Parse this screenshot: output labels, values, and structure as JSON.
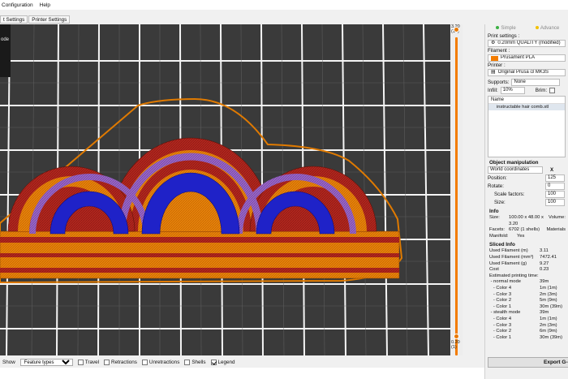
{
  "menu": {
    "items": [
      "Configuration",
      "Help"
    ]
  },
  "tabs": [
    "t Settings",
    "Printer Settings"
  ],
  "legend_overlay": {
    "lines": [
      "ode"
    ]
  },
  "layer_slider": {
    "top_value": "3.20",
    "top_layer": "(16)",
    "bottom_value": "0.20",
    "bottom_layer": "(1)",
    "color": "#f37c00"
  },
  "bottom_bar": {
    "show_label": "Show",
    "view_type": "Feature types",
    "options": [
      {
        "label": "Travel",
        "checked": false
      },
      {
        "label": "Retractions",
        "checked": false
      },
      {
        "label": "Unretractions",
        "checked": false
      },
      {
        "label": "Shells",
        "checked": false
      },
      {
        "label": "Legend",
        "checked": true
      }
    ]
  },
  "sidebar": {
    "mode_simple": "Simple",
    "mode_advanced": "Advance",
    "print_settings_label": "Print settings :",
    "print_settings_value": "0.20mm QUALITY (modified)",
    "filament_label": "Filament :",
    "filament_value": "Prusament PLA",
    "filament_color": "#f37c00",
    "printer_label": "Printer :",
    "printer_value": "Original Prusa i3 MK3S",
    "supports_label": "Supports:",
    "supports_value": "None",
    "infill_label": "Infill:",
    "infill_value": "10%",
    "brim_label": "Brim:",
    "object_list_header": "Name",
    "object_name": "instructable hair comb.stl",
    "object_manipulation_title": "Object manipulation",
    "coords_value": "World coordinates",
    "axis_x": "X",
    "position_label": "Position:",
    "position_x": "125",
    "rotate_label": "Rotate:",
    "rotate_x": "0",
    "scale_label": "Scale factors:",
    "scale_x": "100",
    "size_label": "Size:",
    "size_x": "100",
    "info_title": "Info",
    "info": [
      {
        "k": "Size:",
        "v": "100.00 x 48.00 x 3.20"
      },
      {
        "k": "Facets:",
        "v": "6702 (1 shells)"
      },
      {
        "k": "Manifold:",
        "v": "Yes"
      }
    ],
    "info_volume": "Volume:",
    "info_materials": "Materials",
    "sliced_title": "Sliced Info",
    "sliced": [
      {
        "k": "Used Filament (m)",
        "v": "3.11"
      },
      {
        "k": "Used Filament (mm³)",
        "v": "7472.41"
      },
      {
        "k": "Used Filament (g)",
        "v": "9.27"
      },
      {
        "k": "Cost",
        "v": "0.23"
      },
      {
        "k": "Estimated printing time:",
        "v": ""
      },
      {
        "k": " - normal mode",
        "v": "39m"
      },
      {
        "k": "   - Color 4",
        "v": "1m (1m)"
      },
      {
        "k": "   - Color 3",
        "v": "2m (3m)"
      },
      {
        "k": "   - Color 2",
        "v": "5m (9m)"
      },
      {
        "k": "   - Color 1",
        "v": "30m (39m)"
      },
      {
        "k": " - stealth mode",
        "v": "39m"
      },
      {
        "k": "   - Color 4",
        "v": "1m (1m)"
      },
      {
        "k": "   - Color 3",
        "v": "2m (3m)"
      },
      {
        "k": "   - Color 2",
        "v": "6m (9m)"
      },
      {
        "k": "   - Color 1",
        "v": "30m (39m)"
      }
    ],
    "export_label": "Export G-co"
  },
  "colors": {
    "perimeter": "#f37c00",
    "external": "#b3261e",
    "infill": "#1f22c8",
    "gap": "#8e5bb5",
    "bed": "#3a3a3a",
    "grid": "#ffffff"
  }
}
